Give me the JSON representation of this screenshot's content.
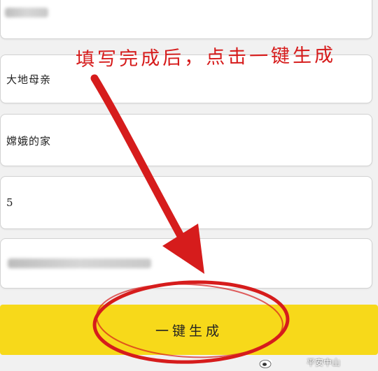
{
  "form": {
    "fields": [
      {
        "value": ""
      },
      {
        "value": "大地母亲"
      },
      {
        "value": "嫦娥的家"
      },
      {
        "value": "5"
      },
      {
        "value": ""
      }
    ],
    "generate_button": "一键生成"
  },
  "annotation": {
    "text": "填写完成后，点击一键生成",
    "color": "#d61c1c"
  },
  "button_color": "#f7d91a",
  "watermark": {
    "text": "平安中山",
    "icon": "weibo-icon"
  }
}
